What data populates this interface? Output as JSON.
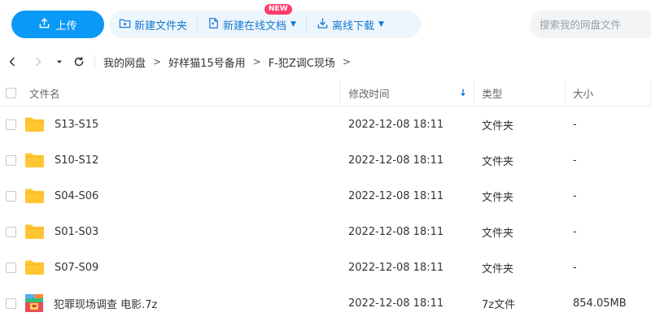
{
  "toolbar": {
    "upload_label": "上传",
    "new_folder_label": "新建文件夹",
    "new_online_doc_label": "新建在线文档",
    "new_badge": "NEW",
    "offline_download_label": "离线下载",
    "search_placeholder": "搜索我的网盘文件"
  },
  "breadcrumb": {
    "items": [
      "我的网盘",
      "好样猫15号备用",
      "F-犯Z调C现场"
    ],
    "separator": ">"
  },
  "table": {
    "headers": {
      "name": "文件名",
      "modified": "修改时间",
      "type": "类型",
      "size": "大小"
    },
    "sort": {
      "column": "modified",
      "direction": "descending"
    },
    "rows": [
      {
        "icon": "folder-icon",
        "name": "S13-S15",
        "modified": "2022-12-08 18:11",
        "type": "文件夹",
        "size": "-"
      },
      {
        "icon": "folder-icon",
        "name": "S10-S12",
        "modified": "2022-12-08 18:11",
        "type": "文件夹",
        "size": "-"
      },
      {
        "icon": "folder-icon",
        "name": "S04-S06",
        "modified": "2022-12-08 18:11",
        "type": "文件夹",
        "size": "-"
      },
      {
        "icon": "folder-icon",
        "name": "S01-S03",
        "modified": "2022-12-08 18:11",
        "type": "文件夹",
        "size": "-"
      },
      {
        "icon": "folder-icon",
        "name": "S07-S09",
        "modified": "2022-12-08 18:11",
        "type": "文件夹",
        "size": "-"
      },
      {
        "icon": "archive-icon",
        "name": "犯罪现场调查 电影.7z",
        "modified": "2022-12-08 18:11",
        "type": "7z文件",
        "size": "854.05MB"
      }
    ]
  },
  "colors": {
    "accent": "#0a99f5",
    "action_text": "#1478d2",
    "action_bg": "#eef6fd",
    "badge": "#ff3d6b",
    "folder": "#ffc634"
  }
}
